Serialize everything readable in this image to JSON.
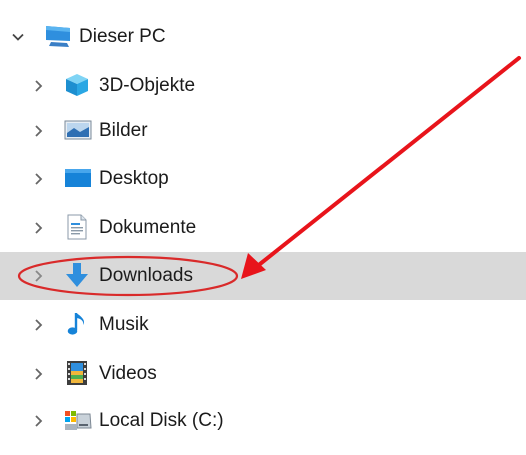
{
  "tree": {
    "root": {
      "label": "Dieser PC",
      "icon": "computer-icon",
      "expanded": true
    },
    "items": [
      {
        "label": "3D-Objekte",
        "icon": "3d-objects-icon",
        "selected": false
      },
      {
        "label": "Bilder",
        "icon": "pictures-icon",
        "selected": false
      },
      {
        "label": "Desktop",
        "icon": "desktop-icon",
        "selected": false
      },
      {
        "label": "Dokumente",
        "icon": "documents-icon",
        "selected": false
      },
      {
        "label": "Downloads",
        "icon": "downloads-icon",
        "selected": true
      },
      {
        "label": "Musik",
        "icon": "music-icon",
        "selected": false
      },
      {
        "label": "Videos",
        "icon": "videos-icon",
        "selected": false
      },
      {
        "label": "Local Disk (C:)",
        "icon": "drive-icon",
        "selected": false
      }
    ]
  },
  "annotation": {
    "arrow_color": "#e8141b",
    "ellipse_color": "#d92a2a"
  },
  "colors": {
    "selected_row": "#d9d9d9",
    "chevron": "#666666"
  }
}
